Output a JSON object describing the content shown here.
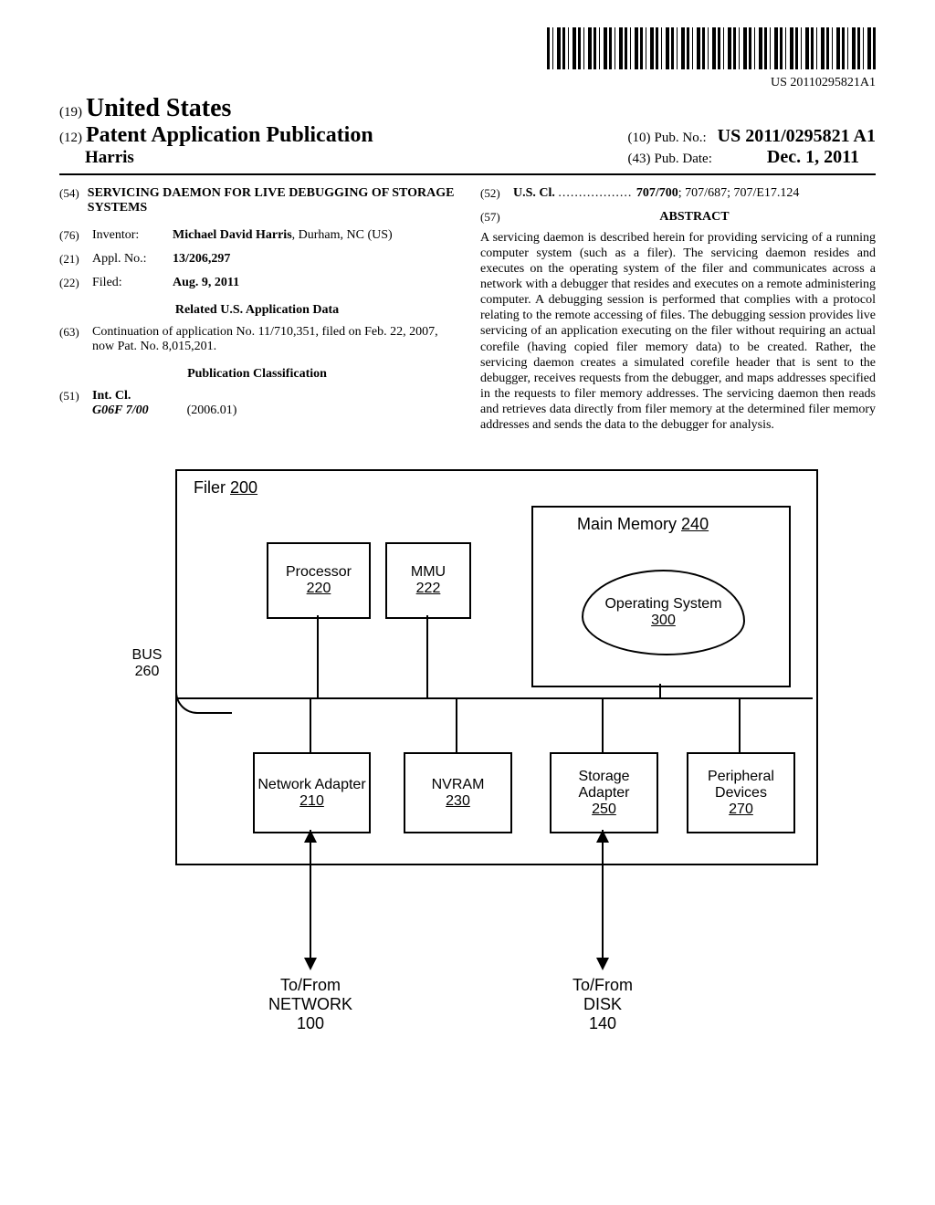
{
  "barcode_number": "US 20110295821A1",
  "header": {
    "code19": "(19)",
    "country": "United States",
    "code12": "(12)",
    "pub_type": "Patent Application Publication",
    "inventor_surname": "Harris",
    "code10": "(10)",
    "pubno_label": "Pub. No.:",
    "pubno": "US 2011/0295821 A1",
    "code43": "(43)",
    "pubdate_label": "Pub. Date:",
    "pubdate": "Dec. 1, 2011"
  },
  "left": {
    "title_code": "(54)",
    "title": "SERVICING DAEMON FOR LIVE DEBUGGING OF STORAGE SYSTEMS",
    "inventor_code": "(76)",
    "inventor_label": "Inventor:",
    "inventor_value": "Michael David Harris, Durham, NC (US)",
    "applno_code": "(21)",
    "applno_label": "Appl. No.:",
    "applno_value": "13/206,297",
    "filed_code": "(22)",
    "filed_label": "Filed:",
    "filed_value": "Aug. 9, 2011",
    "related_head": "Related U.S. Application Data",
    "cont_code": "(63)",
    "cont_text": "Continuation of application No. 11/710,351, filed on Feb. 22, 2007, now Pat. No. 8,015,201.",
    "class_head": "Publication Classification",
    "intcl_code": "(51)",
    "intcl_label": "Int. Cl.",
    "intcl_val": "G06F 7/00",
    "intcl_ver": "(2006.01)"
  },
  "right": {
    "uscl_code": "(52)",
    "uscl_label": "U.S. Cl.",
    "uscl_value": "707/700; 707/687; 707/E17.124",
    "abstract_code": "(57)",
    "abstract_head": "ABSTRACT",
    "abstract_body": "A servicing daemon is described herein for providing servicing of a running computer system (such as a filer). The servicing daemon resides and executes on the operating system of the filer and communicates across a network with a debugger that resides and executes on a remote administering computer. A debugging session is performed that complies with a protocol relating to the remote accessing of files. The debugging session provides live servicing of an application executing on the filer without requiring an actual corefile (having copied filer memory data) to be created. Rather, the servicing daemon creates a simulated corefile header that is sent to the debugger, receives requests from the debugger, and maps addresses specified in the requests to filer memory addresses. The servicing daemon then reads and retrieves data directly from filer memory at the determined filer memory addresses and sends the data to the debugger for analysis."
  },
  "figure": {
    "filer": "Filer",
    "filer_num": "200",
    "processor": "Processor",
    "processor_num": "220",
    "mmu": "MMU",
    "mmu_num": "222",
    "memory": "Main Memory",
    "memory_num": "240",
    "os": "Operating System",
    "os_num": "300",
    "bus": "BUS",
    "bus_num": "260",
    "net": "Network Adapter",
    "net_num": "210",
    "nvram": "NVRAM",
    "nvram_num": "230",
    "stor": "Storage Adapter",
    "stor_num": "250",
    "peri": "Peripheral Devices",
    "peri_num": "270",
    "net_dest1": "To/From",
    "net_dest2": "NETWORK",
    "net_dest_num": "100",
    "disk_dest1": "To/From",
    "disk_dest2": "DISK",
    "disk_dest_num": "140"
  }
}
